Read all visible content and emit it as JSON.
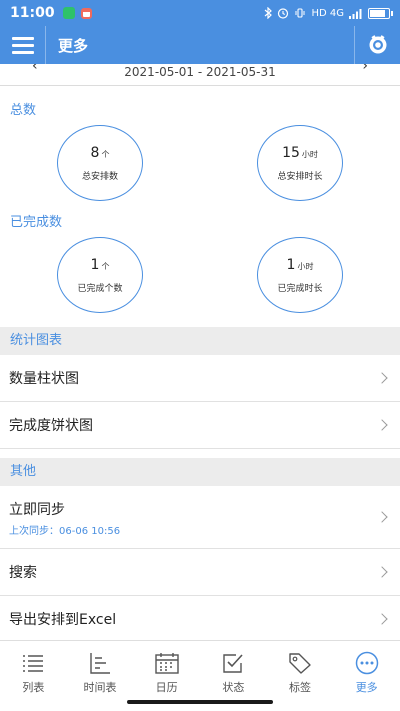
{
  "status_bar": {
    "time": "11:00",
    "right_text": "HD 4G",
    "battery_level": 0.9
  },
  "app_bar": {
    "title": "更多"
  },
  "date_range": {
    "text": "2021-05-01 - 2021-05-31"
  },
  "totals": {
    "section_label": "总数",
    "count": {
      "value": "8",
      "unit": "个",
      "label": "总安排数"
    },
    "duration": {
      "value": "15",
      "unit": "小时",
      "label": "总安排时长"
    }
  },
  "completed": {
    "section_label": "已完成数",
    "count": {
      "value": "1",
      "unit": "个",
      "label": "已完成个数"
    },
    "duration": {
      "value": "1",
      "unit": "小时",
      "label": "已完成时长"
    }
  },
  "charts_section": {
    "header": "统计图表",
    "items": [
      {
        "label": "数量柱状图"
      },
      {
        "label": "完成度饼状图"
      }
    ]
  },
  "other_section": {
    "header": "其他",
    "sync": {
      "label": "立即同步",
      "sub": "上次同步：06-06 10:56"
    },
    "search": {
      "label": "搜索"
    },
    "export": {
      "label": "导出安排到Excel"
    }
  },
  "bottom_nav": {
    "items": [
      {
        "label": "列表",
        "icon": "list-icon"
      },
      {
        "label": "时间表",
        "icon": "timeline-icon"
      },
      {
        "label": "日历",
        "icon": "calendar-icon"
      },
      {
        "label": "状态",
        "icon": "checkbox-icon"
      },
      {
        "label": "标签",
        "icon": "tag-icon"
      },
      {
        "label": "更多",
        "icon": "more-icon"
      }
    ],
    "active": "更多"
  },
  "colors": {
    "accent": "#4a8fe0",
    "header_bg": "#ececec"
  }
}
